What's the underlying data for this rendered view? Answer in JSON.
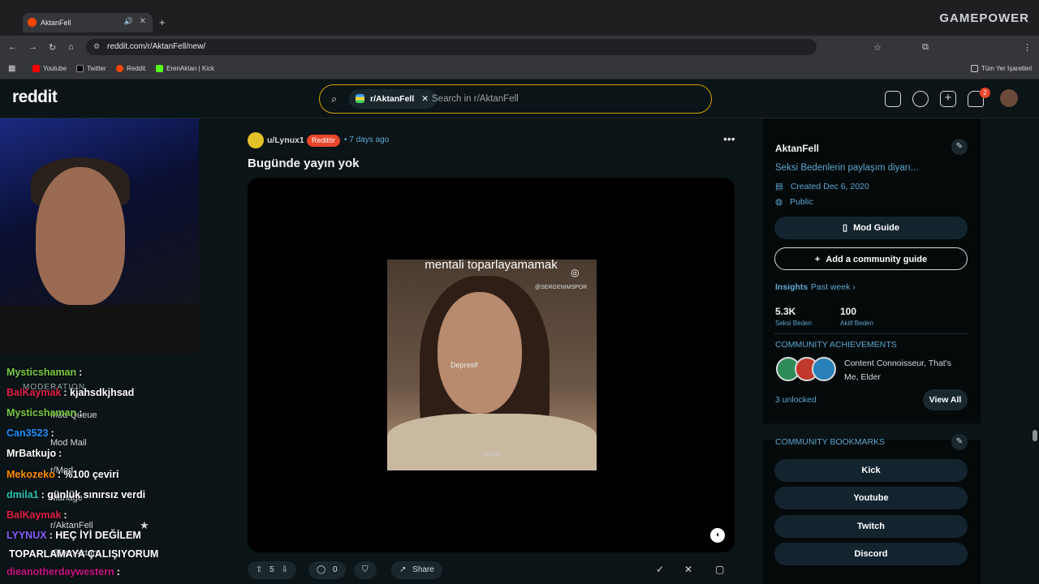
{
  "browser": {
    "tab_title": "AktanFell",
    "url": "reddit.com/r/AktanFell/new/",
    "overlay_brand": "GAMEPOWER",
    "bookmarks": [
      {
        "label": "Youtube",
        "color": "#ff0000"
      },
      {
        "label": "Twitter",
        "color": "#000000"
      },
      {
        "label": "Reddit",
        "color": "#ff4500"
      },
      {
        "label": "ErenAktan | Kick",
        "color": "#53fc18"
      }
    ],
    "all_bookmarks": "Tüm Yer İşaretleri"
  },
  "reddit": {
    "logo": "reddit",
    "search_chip": "r/AktanFell",
    "search_placeholder": "Search in r/AktanFell",
    "notifications_count": "2"
  },
  "left_nav": {
    "section": "MODERATION",
    "items": [
      "Mod Queue",
      "Mod Mail",
      "r/Mod",
      "Manage",
      "r/AktanFell",
      "r/ErenAktan"
    ]
  },
  "chat": [
    {
      "user": "Mysticshaman",
      "msg": ":",
      "color": "#7ac943"
    },
    {
      "user": "BalKaymak",
      "msg": ": kjahsdkjhsad",
      "color": "#e0224a"
    },
    {
      "user": "Mysticshaman",
      "msg": ":",
      "color": "#7ac943"
    },
    {
      "user": "Can3523",
      "msg": ":",
      "color": "#1e90ff"
    },
    {
      "user": "MrBatkujo",
      "msg": ":",
      "color": "#ffffff"
    },
    {
      "user": "Mekozeko",
      "msg": ": %100 çeviri",
      "color": "#ff8c00"
    },
    {
      "user": "dmila1",
      "msg": ": günlük sınırsız verdi",
      "color": "#2ec4b6"
    },
    {
      "user": "BalKaymak",
      "msg": ":",
      "color": "#e0224a"
    },
    {
      "user": "LYYNUX",
      "msg": ": HEÇ İYİ DEĞİLEM",
      "color": "#8a5cff"
    },
    {
      "user": "",
      "msg": "TOPARLAMAYA ÇALIŞIYORUM",
      "color": "#ffffff"
    },
    {
      "user": "dieanotherdaywestern",
      "msg": ":",
      "color": "#c71585"
    }
  ],
  "post": {
    "username": "u/Lynux1",
    "flair": "Reditör",
    "time_ago": "7 days ago",
    "title": "Bugünde yayın yok",
    "video_caption": "mentali toparlayamamak",
    "video_watermark": "@SERGENIMSPOR",
    "video_subtitle": "Depresif",
    "video_tag": "yasqn",
    "votes": "5",
    "comments": "0",
    "share": "Share"
  },
  "sidebar": {
    "name": "AktanFell",
    "description": "Seksi Bedenlerin paylaşım diyarı...",
    "created": "Created Dec 6, 2020",
    "visibility": "Public",
    "mod_guide": "Mod Guide",
    "add_guide": "Add a community guide",
    "insights": "Insights",
    "insights_range": "Past week ›",
    "members_value": "5.3K",
    "members_label": "Seksi Beden",
    "active_value": "100",
    "active_label": "Aktif Beden",
    "achievements_title": "COMMUNITY ACHIEVEMENTS",
    "achievements_text": "Content Connoisseur, That's Me, Elder",
    "unlocked": "3 unlocked",
    "view_all": "View All",
    "bookmarks_title": "COMMUNITY BOOKMARKS",
    "bookmarks": [
      "Kick",
      "Youtube",
      "Twitch",
      "Discord"
    ],
    "accent": "#5fa8d3"
  }
}
